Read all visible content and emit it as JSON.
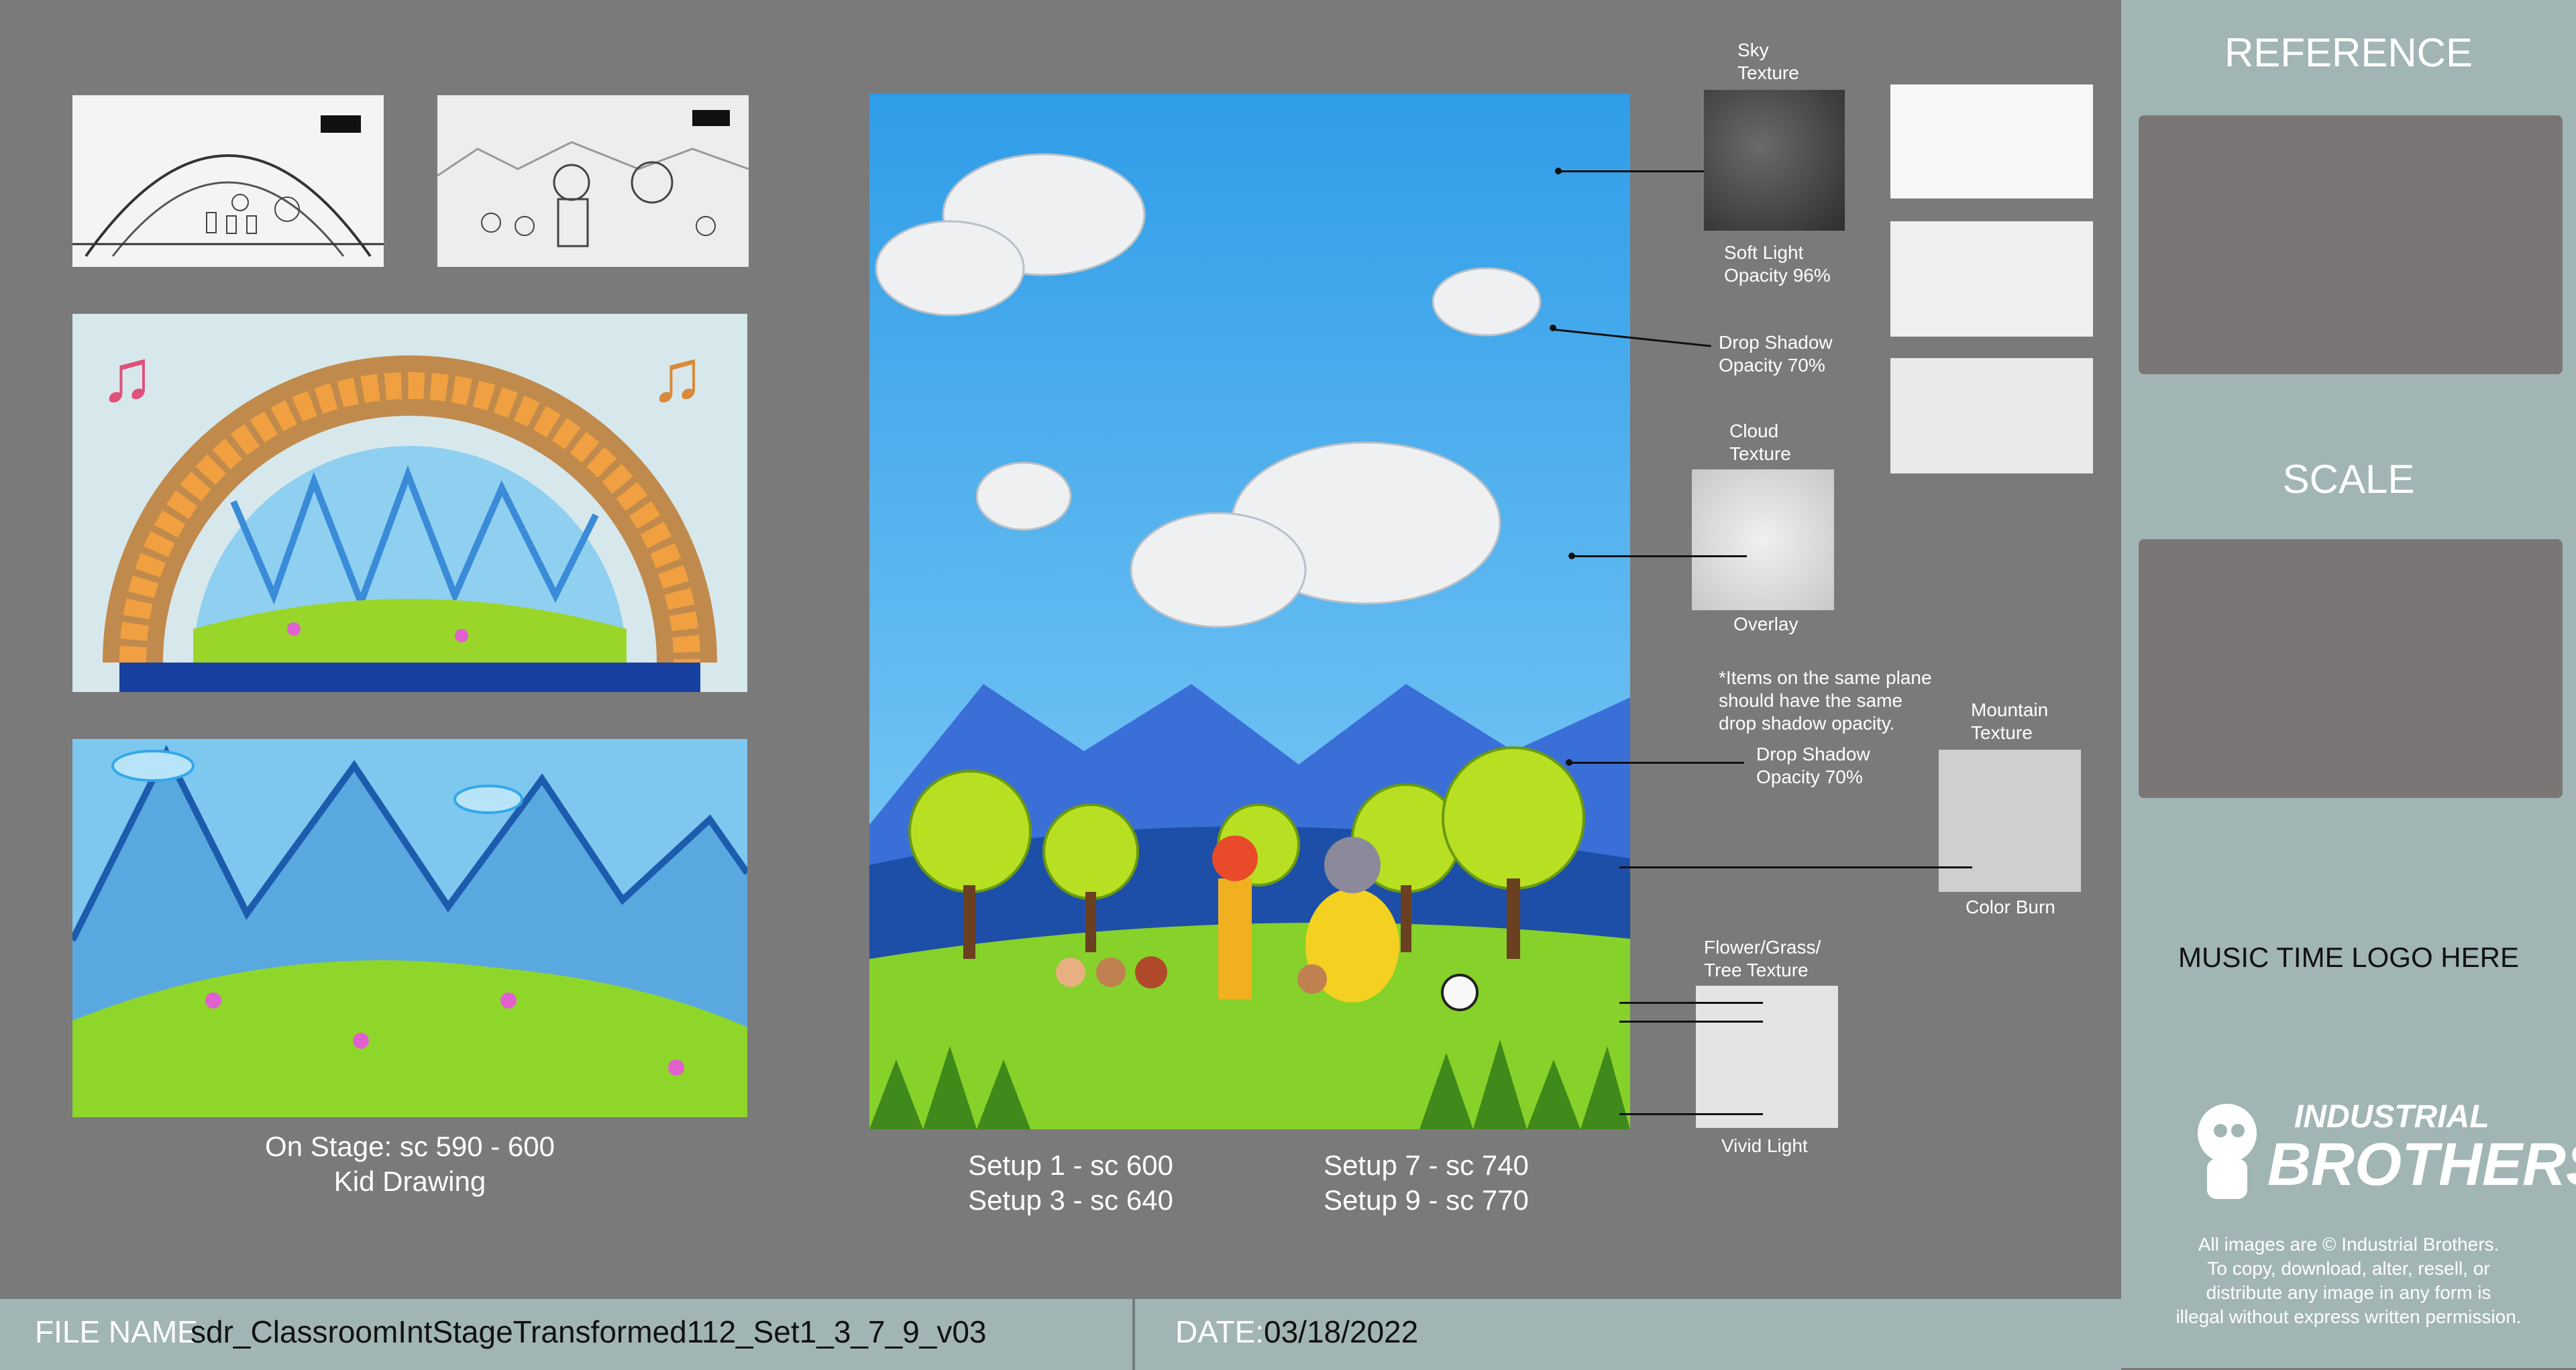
{
  "left_captions": {
    "line1": "On Stage: sc 590 - 600",
    "line2": "Kid Drawing"
  },
  "center_captions": {
    "left_line1": "Setup 1 - sc 600",
    "left_line2": "Setup 3 - sc 640",
    "right_line1": "Setup 7 - sc 740",
    "right_line2": "Setup 9 - sc 770"
  },
  "textures": {
    "sky_title": "Sky\nTexture",
    "sky_mode": "Soft Light\nOpacity 96%",
    "drop_shadow_1": "Drop Shadow\nOpacity 70%",
    "cloud_title": "Cloud\nTexture",
    "cloud_mode": "Overlay",
    "note": "*Items on the same plane\nshould have the same\ndrop shadow opacity.",
    "drop_shadow_2": "Drop Shadow\nOpacity 70%",
    "mountain_title": "Mountain\nTexture",
    "mountain_mode": "Color Burn",
    "flower_title": "Flower/Grass/\nTree Texture",
    "flower_mode": "Vivid Light"
  },
  "sidebar": {
    "reference_title": "REFERENCE",
    "scale_title": "SCALE",
    "logo_placeholder": "MUSIC TIME LOGO HERE",
    "brand_line1": "INDUSTRIAL",
    "brand_line2": "BROTHERS",
    "copyright": "All images are © Industrial Brothers.\nTo copy, download, alter, resell, or\ndistribute any image in any form is\nillegal without express written permission."
  },
  "bottom_bar": {
    "file_label": "FILE NAME:",
    "file_value": "sdr_ClassroomIntStageTransformed112_Set1_3_7_9_v03",
    "date_label": "DATE:",
    "date_value": "03/18/2022"
  },
  "colors": {
    "background": "#7a7a7a",
    "sidebar": "#a2b5b5",
    "sky_blue": "#3fa9f5",
    "grass_green": "#7ed321"
  }
}
